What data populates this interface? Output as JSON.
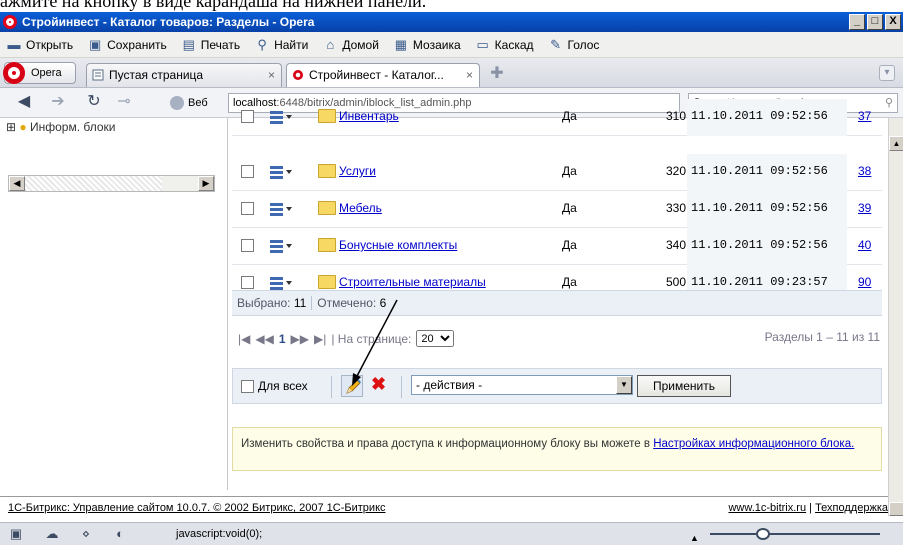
{
  "caption": "ажмите на кнопку в виде карандаша на нижней панели.",
  "window": {
    "title": "Стройинвест - Каталог товаров: Разделы - Opera",
    "min": "_",
    "restore": "□",
    "close": "X"
  },
  "menu": [
    {
      "label": "Открыть",
      "icon": "folder-icon"
    },
    {
      "label": "Сохранить",
      "icon": "save-icon"
    },
    {
      "label": "Печать",
      "icon": "print-icon"
    },
    {
      "label": "Найти",
      "icon": "search-icon"
    },
    {
      "label": "Домой",
      "icon": "home-icon"
    },
    {
      "label": "Мозаика",
      "icon": "tile-icon"
    },
    {
      "label": "Каскад",
      "icon": "cascade-icon"
    },
    {
      "label": "Голос",
      "icon": "voice-icon"
    }
  ],
  "tabs": {
    "opera_menu": "Opera",
    "items": [
      {
        "label": "Пустая страница"
      },
      {
        "label": "Стройинвест - Каталог..."
      }
    ]
  },
  "address": {
    "veb": "Веб",
    "host": "localhost",
    "path": ":6448/bitrix/admin/iblock_list_admin.php",
    "search_placeholder": "Искать в Google"
  },
  "left": {
    "tree_item": "Информ. блоки"
  },
  "table": {
    "rows": [
      {
        "name": "Инвентарь",
        "active": "Да",
        "sort": "310",
        "date": "11.10.2011 09:52:56",
        "id": "37"
      },
      {
        "name": "Услуги",
        "active": "Да",
        "sort": "320",
        "date": "11.10.2011 09:52:56",
        "id": "38"
      },
      {
        "name": "Мебель",
        "active": "Да",
        "sort": "330",
        "date": "11.10.2011 09:52:56",
        "id": "39"
      },
      {
        "name": "Бонусные комплекты",
        "active": "Да",
        "sort": "340",
        "date": "11.10.2011 09:52:56",
        "id": "40"
      },
      {
        "name": "Строительные материалы",
        "active": "Да",
        "sort": "500",
        "date": "11.10.2011 09:23:57",
        "id": "90"
      }
    ]
  },
  "summary": {
    "selected_label": "Выбрано:",
    "selected_value": "11",
    "checked_label": "Отмечено:",
    "checked_value": "6"
  },
  "pager": {
    "nav_first": "|◀",
    "nav_prev": "◀◀",
    "current": "1",
    "nav_next": "▶▶",
    "nav_last": "▶|",
    "per_page_label": "| На странице:",
    "per_page_value": "20",
    "range": "Разделы 1 – 11 из 11"
  },
  "actions": {
    "for_all": "Для всех",
    "select_value": "- действия -",
    "apply": "Применить"
  },
  "note": {
    "text": "Изменить свойства и права доступа к информационному блоку вы можете в",
    "link": "Настройках информационного блока."
  },
  "footer": {
    "left": "1С-Битрикс: Управление сайтом 10.0.7. © 2002 Битрикс, 2007 1С-Битрикс",
    "site": "www.1c-bitrix.ru",
    "sep": "|",
    "support": "Техподдержка"
  },
  "status": {
    "text": "javascript:void(0);"
  }
}
